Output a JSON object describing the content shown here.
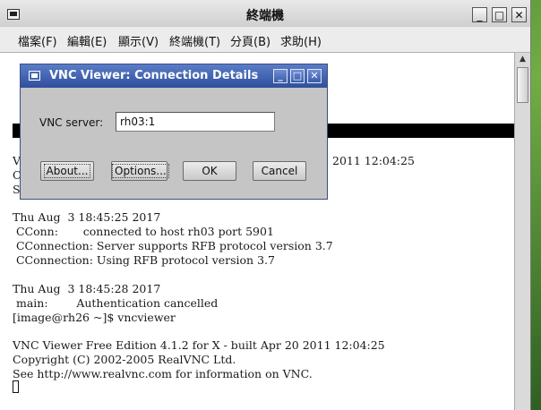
{
  "terminal": {
    "title": "終端機",
    "controls": {
      "minimize": "_",
      "maximize": "□",
      "close": "✕"
    },
    "menu": [
      "檔案(F)",
      "編輯(E)",
      "顯示(V)",
      "終端機(T)",
      "分頁(B)",
      "求助(H)"
    ],
    "lines_partial": [
      {
        "text": "VN",
        "suffix": "2011 12:04:25"
      },
      {
        "text": "Co"
      },
      {
        "text": "Se"
      }
    ],
    "lines": [
      "Thu Aug  3 18:45:25 2017",
      " CConn:       connected to host rh03 port 5901",
      " CConnection: Server supports RFB protocol version 3.7",
      " CConnection: Using RFB protocol version 3.7",
      "",
      "Thu Aug  3 18:45:28 2017",
      " main:        Authentication cancelled",
      "[image@rh26 ~]$ vncviewer",
      "",
      "VNC Viewer Free Edition 4.1.2 for X - built Apr 20 2011 12:04:25",
      "Copyright (C) 2002-2005 RealVNC Ltd.",
      "See http://www.realvnc.com for information on VNC."
    ]
  },
  "vnc_dialog": {
    "title": "VNC Viewer: Connection Details",
    "controls": {
      "minimize": "_",
      "maximize": "□",
      "close": "✕"
    },
    "server_label": "VNC server:",
    "server_value": "rh03:1",
    "buttons": {
      "about": "About...",
      "options": "Options...",
      "ok": "OK",
      "cancel": "Cancel"
    }
  }
}
